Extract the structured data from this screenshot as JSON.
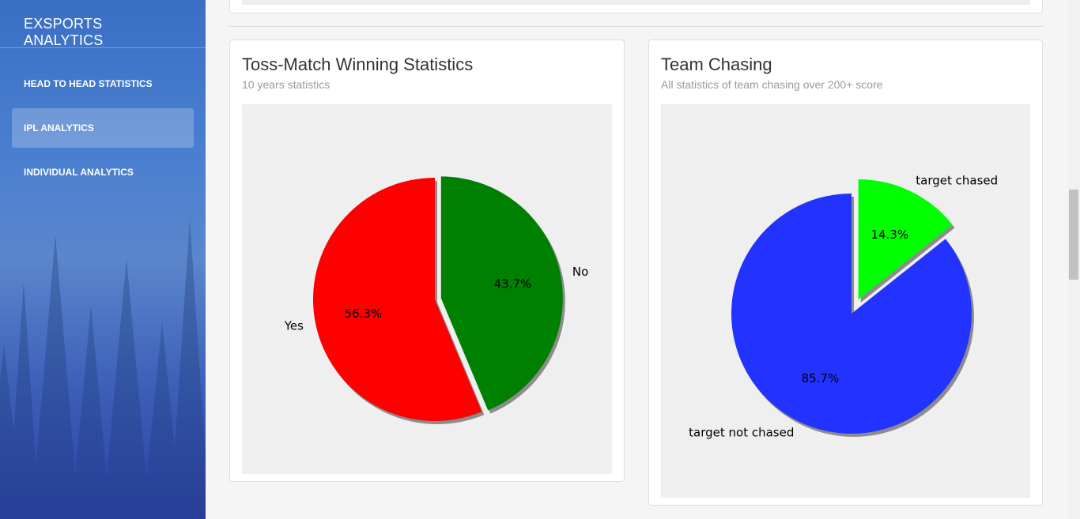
{
  "sidebar": {
    "brand": "EXSPORTS ANALYTICS",
    "items": [
      {
        "label": "HEAD TO HEAD STATISTICS",
        "active": false
      },
      {
        "label": "IPL ANALYTICS",
        "active": true
      },
      {
        "label": "INDIVIDUAL ANALYTICS",
        "active": false
      }
    ]
  },
  "cards": {
    "toss": {
      "title": "Toss-Match Winning Statistics",
      "subtitle": "10 years statistics"
    },
    "chasing": {
      "title": "Team Chasing",
      "subtitle": "All statistics of team chasing over 200+ score"
    }
  },
  "chart_data": [
    {
      "type": "pie",
      "title": "",
      "categories": [
        "Yes",
        "No"
      ],
      "values": [
        56.3,
        43.7
      ],
      "value_labels": [
        "56.3%",
        "43.7%"
      ],
      "colors": [
        "#ff0000",
        "#008000"
      ],
      "exploded": [
        "No"
      ],
      "shadow": true
    },
    {
      "type": "pie",
      "title": "",
      "categories": [
        "target not chased",
        "target chased"
      ],
      "values": [
        85.7,
        14.3
      ],
      "value_labels": [
        "85.7%",
        "14.3%"
      ],
      "colors": [
        "#2233ff",
        "#00ff00"
      ],
      "exploded": [
        "target chased"
      ],
      "shadow": true
    }
  ],
  "colors": {
    "card_border": "#dedede",
    "chart_background": "#efefef",
    "sidebar_top": "#3a6fc4",
    "sidebar_bottom": "#2e3fa8"
  }
}
